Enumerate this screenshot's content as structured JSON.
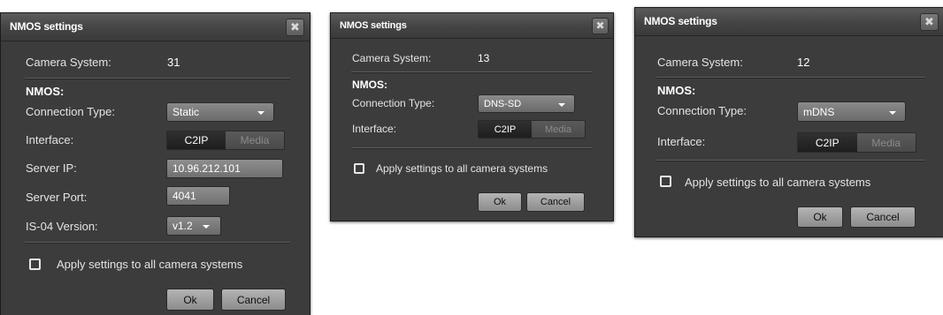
{
  "dialogs": [
    {
      "title": "NMOS settings",
      "close_glyph": "✖",
      "camera_system_label": "Camera System:",
      "camera_system_value": "31",
      "section_label": "NMOS:",
      "connection_type_label": "Connection Type:",
      "connection_type_value": "Static",
      "interface_label": "Interface:",
      "interface_options": [
        "C2IP",
        "Media"
      ],
      "interface_selected": "C2IP",
      "server_ip_label": "Server IP:",
      "server_ip_value": "10.96.212.101",
      "server_port_label": "Server Port:",
      "server_port_value": "4041",
      "is04_label": "IS-04 Version:",
      "is04_value": "v1.2",
      "apply_all_label": "Apply settings to all camera systems",
      "apply_all_checked": false,
      "ok_label": "Ok",
      "cancel_label": "Cancel"
    },
    {
      "title": "NMOS settings",
      "close_glyph": "✖",
      "camera_system_label": "Camera System:",
      "camera_system_value": "13",
      "section_label": "NMOS:",
      "connection_type_label": "Connection Type:",
      "connection_type_value": "DNS-SD",
      "interface_label": "Interface:",
      "interface_options": [
        "C2IP",
        "Media"
      ],
      "interface_selected": "C2IP",
      "apply_all_label": "Apply settings to all camera systems",
      "apply_all_checked": false,
      "ok_label": "Ok",
      "cancel_label": "Cancel"
    },
    {
      "title": "NMOS settings",
      "close_glyph": "✖",
      "camera_system_label": "Camera System:",
      "camera_system_value": "12",
      "section_label": "NMOS:",
      "connection_type_label": "Connection Type:",
      "connection_type_value": "mDNS",
      "interface_label": "Interface:",
      "interface_options": [
        "C2IP",
        "Media"
      ],
      "interface_selected": "C2IP",
      "apply_all_label": "Apply settings to all camera systems",
      "apply_all_checked": false,
      "ok_label": "Ok",
      "cancel_label": "Cancel"
    }
  ],
  "colors": {
    "dialog_bg": "#3c3c3c",
    "titlebar": "#4a4a4a",
    "toggle_selected": "#262626",
    "button_face": "#a0a0a0"
  },
  "icons": {
    "close": "close-icon",
    "dropdown": "chevron-down-icon",
    "checkbox": "checkbox-icon"
  }
}
